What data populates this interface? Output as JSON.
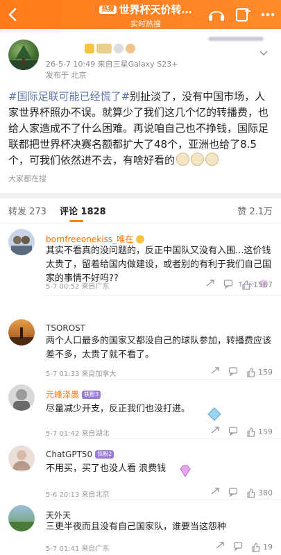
{
  "header": {
    "title": "世界杯天价转…",
    "badge": "热搜",
    "subtitle": "实时热搜",
    "listen_label": "听",
    "colors": {
      "accent": "#ff8200",
      "bg": "#ff7a1a"
    }
  },
  "post": {
    "meta": "26-5-7 10:49  来自三星Galaxy S23+",
    "location": "发布于 北京",
    "hashtag": "#国际足联可能已经慌了#",
    "content": "别扯淡了，没有中国市场，人家世界杯照办不误。就算少了我们这几个亿的转播费，也给人家造成不了什么困难。再说咱自己也不挣钱，国际足联都把世界杯决赛名额都扩大了48个，亚洲也给了8.5个，可我们依然进不去，有啥好看的",
    "searching": "大家都在搜"
  },
  "tabs": {
    "repost": "转发 273",
    "comments": "评论 1828",
    "likes": "赞 2.1万"
  },
  "comments": [
    {
      "name": "bornfreeonekiss_唯在",
      "text": "其实不看真的没问题的，反正中国队又没有入围...这价钱太贵了，留着给国内做建设，或者别的有利于我们自己国家的事情不好吗??",
      "time": "5-7 00:52  来自广东",
      "likes": "1567"
    },
    {
      "name": "TSOROST",
      "text": "两个人口最多的国家又都没自己的球队参加，转播费应该差不多，太贵了就不看了。",
      "time": "5-7 01:33  来自加拿大",
      "likes": "159"
    },
    {
      "name": "元峰泽愚",
      "level": "铁粉3",
      "text": "尽量减少开支，反正我们也没打进。",
      "time": "5-7 01:42  来自湖北",
      "likes": "159"
    },
    {
      "name": "ChatGPT50",
      "level": "铁粉2",
      "text": "不用买，买了也没人看 浪费钱",
      "time": "5-6 20:13  来自北京",
      "likes": "380"
    },
    {
      "name": "天外天",
      "text": "三更半夜而且没有自己国家队，谁要当这怨种",
      "time": "5-7 01:41  来自广东",
      "likes": "19"
    }
  ]
}
